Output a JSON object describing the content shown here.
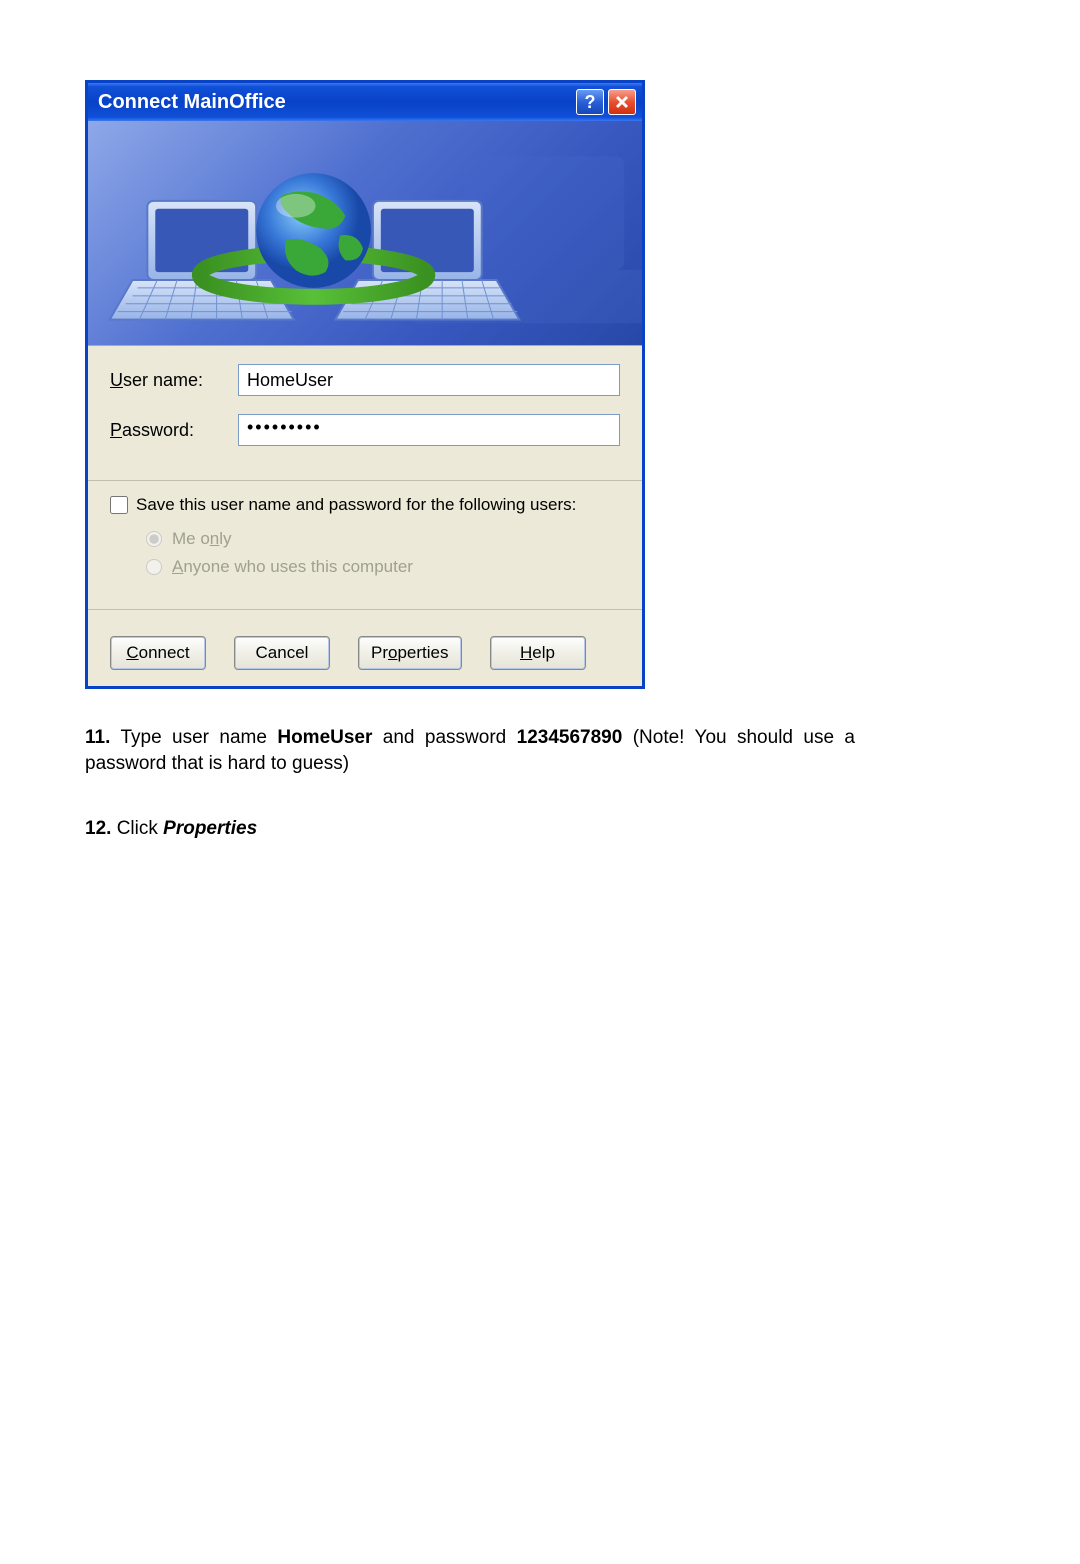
{
  "dialog": {
    "title": "Connect MainOffice",
    "username_label_pre": "U",
    "username_label_post": "ser name:",
    "username_value": "HomeUser",
    "password_label_pre": "P",
    "password_label_post": "assword:",
    "password_value": "•••••••••",
    "save_checkbox_pre": "S",
    "save_checkbox_post": "ave this user name and password for the following users:",
    "radio_me_pre": "Me o",
    "radio_me_u": "n",
    "radio_me_post": "ly",
    "radio_anyone_pre": "A",
    "radio_anyone_post": "nyone who uses this computer",
    "btn_connect_pre": "C",
    "btn_connect_post": "onnect",
    "btn_cancel": "Cancel",
    "btn_properties_pre": "Pr",
    "btn_properties_u": "o",
    "btn_properties_post": "perties",
    "btn_help_pre": "H",
    "btn_help_post": "elp"
  },
  "instructions": {
    "step11_num": "11.",
    "step11_a": " Type user name ",
    "step11_b": "HomeUser",
    "step11_c": " and password ",
    "step11_d": "1234567890",
    "step11_e": " (Note! You should use a password that is hard to guess)",
    "step12_num": "12.",
    "step12_a": " Click ",
    "step12_b": "Properties"
  }
}
